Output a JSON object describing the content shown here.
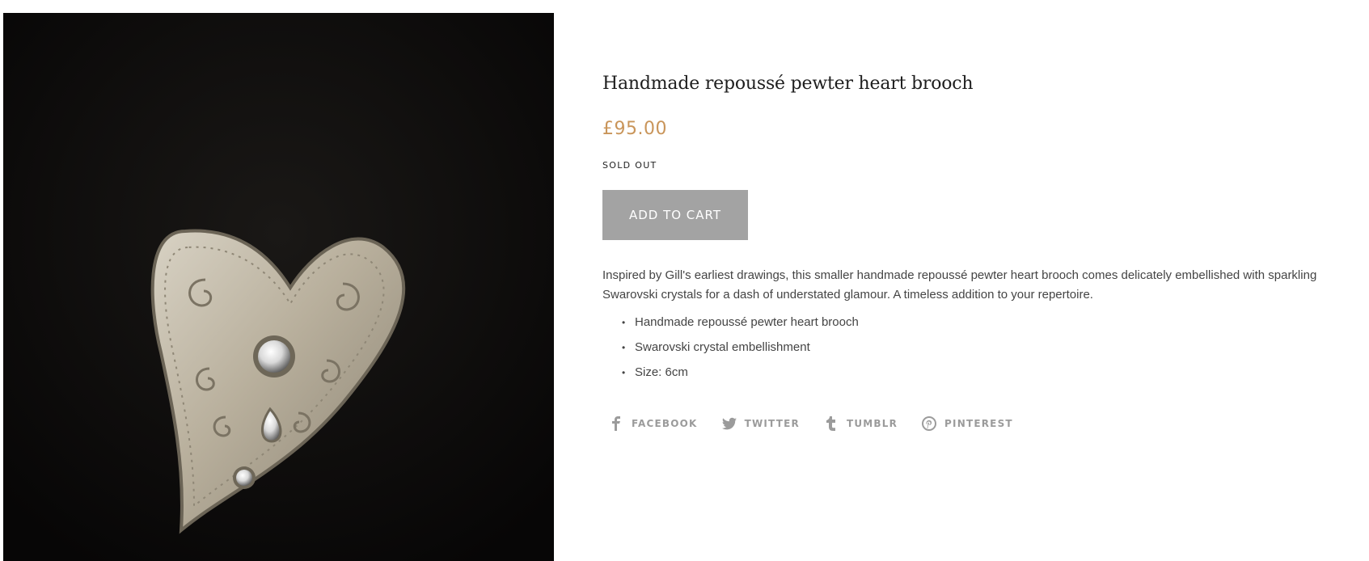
{
  "product": {
    "title": "Handmade repoussé pewter heart brooch",
    "price": "£95.00",
    "availability": "SOLD OUT",
    "add_to_cart_label": "ADD TO CART",
    "description": "Inspired by Gill's earliest drawings, this smaller handmade repoussé pewter heart brooch comes delicately embellished with sparkling Swarovski crystals for a dash of understated glamour. A timeless addition to your repertoire.",
    "features": [
      "Handmade repoussé pewter heart brooch",
      "Swarovski crystal embellishment",
      "Size: 6cm"
    ]
  },
  "share": {
    "facebook": {
      "label": "FACEBOOK",
      "icon": "facebook-icon"
    },
    "twitter": {
      "label": "TWITTER",
      "icon": "twitter-icon"
    },
    "tumblr": {
      "label": "TUMBLR",
      "icon": "tumblr-icon"
    },
    "pinterest": {
      "label": "PINTEREST",
      "icon": "pinterest-icon"
    }
  },
  "colors": {
    "price": "#c9955a",
    "button_disabled": "#a3a3a3",
    "share_text": "#9b9b9b",
    "image_background": "#0c0b0a"
  }
}
